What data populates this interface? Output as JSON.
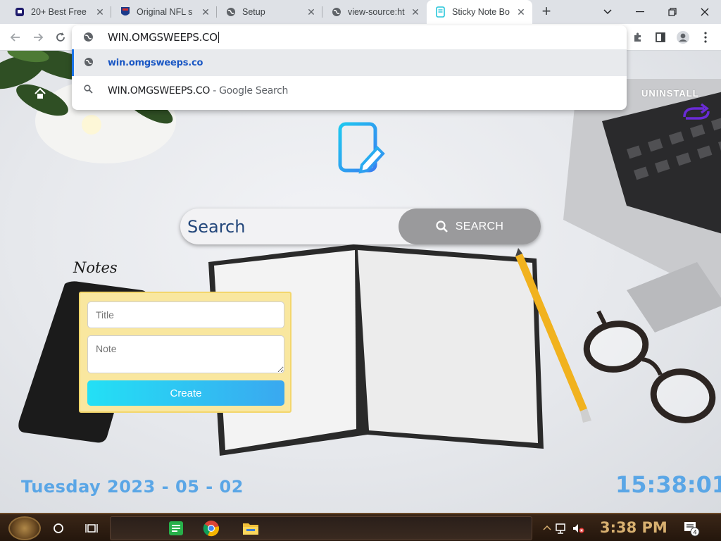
{
  "browser": {
    "tabs": [
      {
        "title": "20+ Best Free",
        "favicon": "tv-icon",
        "active": false
      },
      {
        "title": "Original NFL s",
        "favicon": "nfl-icon",
        "active": false
      },
      {
        "title": "Setup",
        "favicon": "globe-icon",
        "active": false
      },
      {
        "title": "view-source:ht",
        "favicon": "globe-icon",
        "active": false
      },
      {
        "title": "Sticky Note Bo",
        "favicon": "note-icon",
        "active": true
      }
    ],
    "omnibox": {
      "typed_text": "WIN.OMGSWEEPS.CO",
      "suggestions": [
        {
          "text": "win.omgsweeps.co",
          "icon": "globe-icon",
          "selected": true
        },
        {
          "text": "WIN.OMGSWEEPS.CO",
          "suffix": " - Google Search",
          "icon": "search-icon",
          "selected": false
        }
      ]
    }
  },
  "page": {
    "uninstall_label": "UNINSTALL",
    "search": {
      "placeholder": "Search",
      "button_label": "SEARCH"
    },
    "notes": {
      "heading": "Notes",
      "title_placeholder": "Title",
      "note_placeholder": "Note",
      "create_label": "Create"
    },
    "date": "Tuesday 2023 - 05 - 02",
    "clock": "15:38:01",
    "colors": {
      "accent_blue": "#5aa6e6",
      "note_yellow": "#f9e79f",
      "create_gradient_start": "#23e0f5",
      "create_gradient_end": "#3aa8f0",
      "search_button_gray": "#9a9a9c"
    }
  },
  "taskbar": {
    "time": "3:38 PM",
    "notification_count": "4"
  }
}
